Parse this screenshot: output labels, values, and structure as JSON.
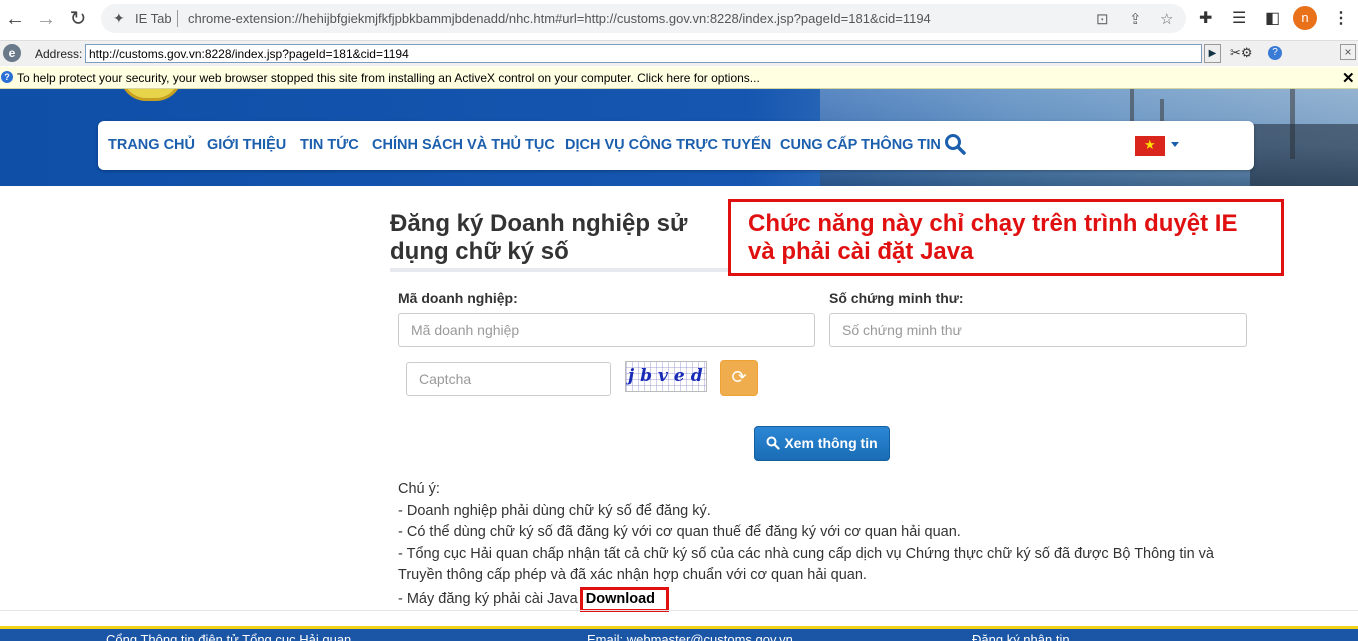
{
  "browser": {
    "tab_name": "IE Tab",
    "url": "chrome-extension://hehijbfgiekmjfkfjpbkbammjbdenadd/nhc.htm#url=http://customs.gov.vn:8228/index.jsp?pageId=181&cid=1194",
    "profile_initial": "n"
  },
  "ie_bar": {
    "address_label": "Address:",
    "address_value": "http://customs.gov.vn:8228/index.jsp?pageId=181&cid=1194"
  },
  "info_bar": {
    "text": "To help protect your security, your web browser stopped this site from installing an ActiveX control on your computer. Click here for options..."
  },
  "nav": {
    "items": [
      {
        "label": "TRANG CHỦ"
      },
      {
        "label": "GIỚI THIỆU"
      },
      {
        "label": "TIN TỨC"
      },
      {
        "label": "CHÍNH SÁCH VÀ THỦ TỤC"
      },
      {
        "label": "DỊCH VỤ CÔNG TRỰC TUYẾN"
      },
      {
        "label": "CUNG CẤP THÔNG TIN"
      }
    ],
    "flag_star": "★"
  },
  "page": {
    "title": "Đăng ký Doanh nghiệp sử dụng chữ ký số",
    "notice": "Chức năng này chỉ chạy trên trình duyệt IE và phải cài đặt Java"
  },
  "form": {
    "business_code_label": "Mã doanh nghiệp:",
    "business_code_placeholder": "Mã doanh nghiệp",
    "id_number_label": "Số chứng minh thư:",
    "id_number_placeholder": "Số chứng minh thư",
    "captcha_placeholder": "Captcha",
    "captcha_text": "jbved",
    "submit_label": "Xem thông tin"
  },
  "notes": {
    "heading": "Chú ý:",
    "lines": [
      "- Doanh nghiệp phải dùng chữ ký số để đăng ký.",
      "- Có thể dùng chữ ký số đã đăng ký với cơ quan thuế để đăng ký với cơ quan hải quan.",
      "- Tổng cục Hải quan chấp nhận tất cả chữ ký số của các nhà cung cấp dịch vụ Chứng thực chữ ký số đã được Bộ Thông tin và",
      "Truyền thông cấp phép và đã xác nhận hợp chuẩn với cơ quan hải quan."
    ],
    "java_line": "- Máy đăng ký phải cài Java",
    "download_label": "Download"
  },
  "footer": {
    "portal": "Cổng Thông tin điện tử Tổng cục Hải quan",
    "email": "Email: webmaster@customs.gov.vn",
    "register": "Đăng ký nhận tin"
  }
}
